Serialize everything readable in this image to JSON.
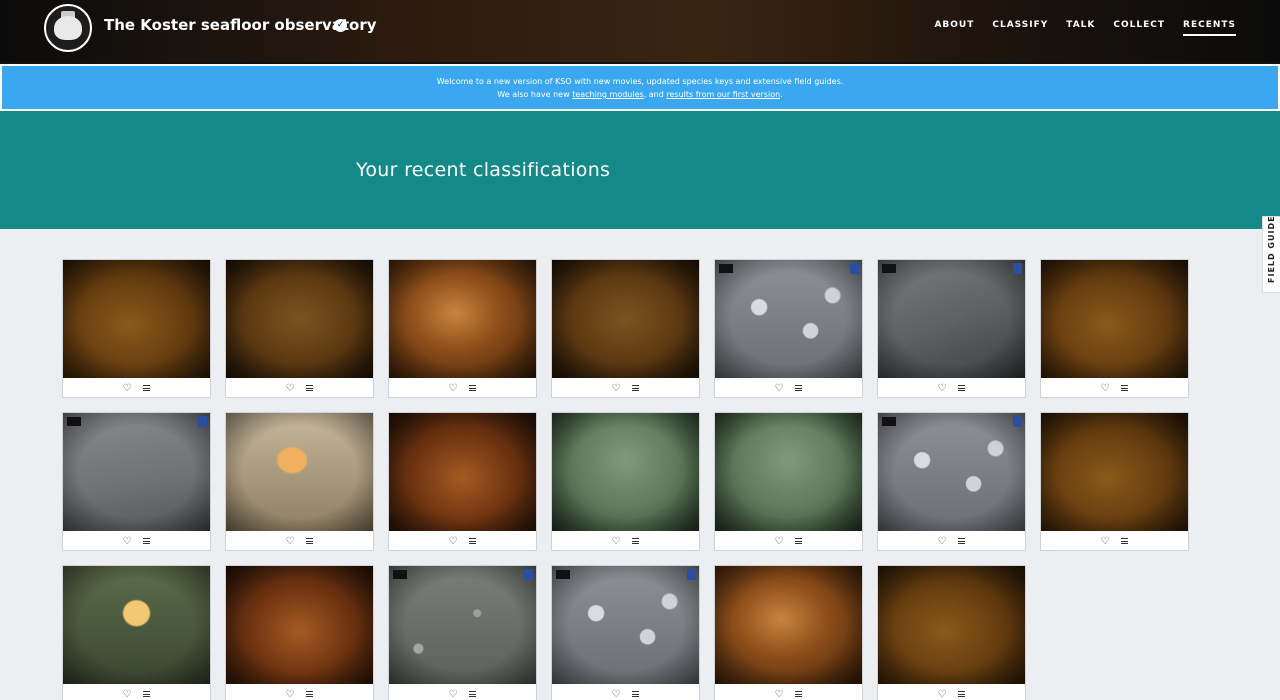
{
  "header": {
    "project_title": "The Koster seafloor observatory",
    "verified_icon": "check-circle-icon",
    "nav": [
      {
        "label": "ABOUT"
      },
      {
        "label": "CLASSIFY"
      },
      {
        "label": "TALK"
      },
      {
        "label": "COLLECT"
      },
      {
        "label": "RECENTS",
        "active": true
      }
    ]
  },
  "announcement": {
    "line1": "Welcome to a new version of KSO with new movies, updated species keys and extensive field guides.",
    "line2_prefix": "We also have new ",
    "link1": "teaching modules",
    "line2_mid": ", and ",
    "link2": "results from our first version",
    "line2_suffix": "."
  },
  "hero": {
    "title": "Your recent classifications"
  },
  "field_guide": {
    "label": "FIELD GUIDE"
  },
  "colors": {
    "accent": "#138988",
    "announce": "#3aa7f0"
  },
  "classifications": [
    {
      "scene": "orange-dark"
    },
    {
      "scene": "orange-brown"
    },
    {
      "scene": "orange-coral"
    },
    {
      "scene": "orange-brown"
    },
    {
      "scene": "grey-anemone"
    },
    {
      "scene": "grey-dim"
    },
    {
      "scene": "orange-dark"
    },
    {
      "scene": "grey-flat"
    },
    {
      "scene": "sea-pen-sand"
    },
    {
      "scene": "orange-rust"
    },
    {
      "scene": "green-murky"
    },
    {
      "scene": "green-murky"
    },
    {
      "scene": "grey-anemone"
    },
    {
      "scene": "orange-dark"
    },
    {
      "scene": "sea-pen-green"
    },
    {
      "scene": "orange-rust"
    },
    {
      "scene": "grey-gravel"
    },
    {
      "scene": "grey-anemone"
    },
    {
      "scene": "orange-coral"
    },
    {
      "scene": "orange-dark"
    }
  ],
  "card_actions": {
    "favorite_icon": "heart-icon",
    "collect_icon": "list-icon"
  }
}
